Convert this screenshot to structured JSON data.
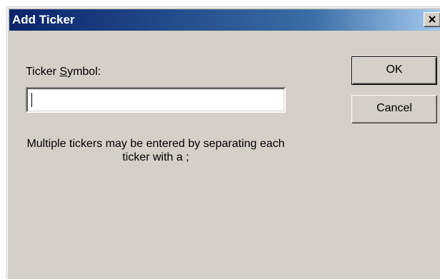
{
  "window": {
    "title": "Add Ticker",
    "close_icon": "close-icon"
  },
  "form": {
    "label_prefix": "Ticker ",
    "label_accel": "S",
    "label_suffix": "ymbol:",
    "ticker_value": "",
    "hint": "Multiple tickers may be entered by separating each ticker with a ;"
  },
  "buttons": {
    "ok_label": "OK",
    "cancel_label": "Cancel"
  },
  "colors": {
    "face": "#d4d0c8",
    "title_start": "#0a246a",
    "title_end": "#a6caf0"
  }
}
